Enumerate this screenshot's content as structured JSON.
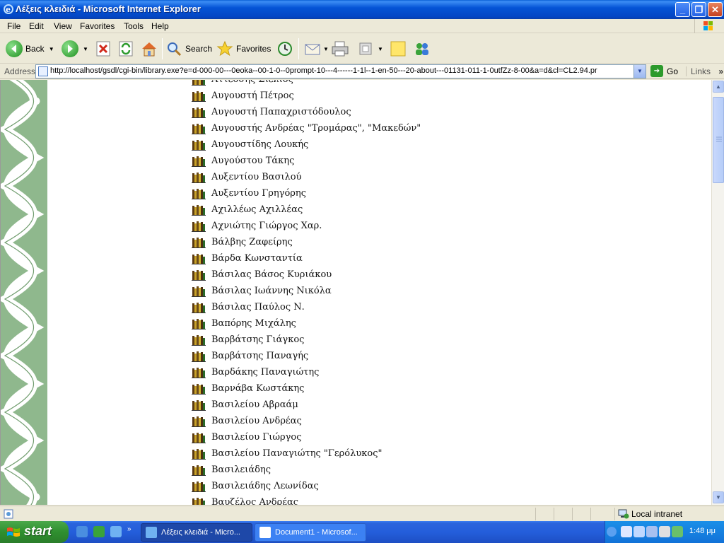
{
  "window": {
    "title": "Λέξεις κλειδιά - Microsoft Internet Explorer"
  },
  "menu": [
    "File",
    "Edit",
    "View",
    "Favorites",
    "Tools",
    "Help"
  ],
  "toolbar": {
    "back": "Back",
    "search": "Search",
    "favorites": "Favorites"
  },
  "address": {
    "label": "Address",
    "url": "http://localhost/gsdl/cgi-bin/library.exe?e=d-000-00---0eoka--00-1-0--0prompt-10---4------1-1l--1-en-50---20-about---01131-011-1-0utfZz-8-00&a=d&cl=CL2.94.pr",
    "go": "Go",
    "links": "Links"
  },
  "list": [
    "Αττεόσης Σίελιος",
    "Αυγουστή Πέτρος",
    "Αυγουστή Παπαχριστόδουλος",
    "Αυγουστής Ανδρέας \"Τρομάρας\", \"Μακεδών\"",
    "Αυγουστίδης Λουκής",
    "Αυγούστου Τάκης",
    "Αυξεντίου Βασιλού",
    "Αυξεντίου Γρηγόρης",
    "Αχιλλέως Αχιλλέας",
    "Αχνιώτης Γιώργος Χαρ.",
    "Βάλβης Ζαφείρης",
    "Βάρδα Κωνσταντία",
    "Βάσιλας Βάσος Κυριάκου",
    "Βάσιλας Ιωάννης Νικόλα",
    "Βάσιλας Παύλος Ν.",
    "Βαπόρης Μιχάλης",
    "Βαρβάτσης Γιάγκος",
    "Βαρβάτσης Παναγής",
    "Βαρδάκης Παναγιώτης",
    "Βαρνάβα Κωστάκης",
    "Βασιλείου Αβραάμ",
    "Βασιλείου Ανδρέας",
    "Βασιλείου Γιώργος",
    "Βασιλείου Παναγιώτης \"Γερόλυκος\"",
    "Βασιλειάδης",
    "Βασιλειάδης Λεωνίδας",
    "Βαυζέλος Ανδρέας"
  ],
  "status": {
    "zone": "Local intranet"
  },
  "taskbar": {
    "start": "start",
    "items": [
      "Λέξεις κλειδιά - Micro...",
      "Document1 - Microsof..."
    ],
    "clock": "1:48 μμ"
  }
}
